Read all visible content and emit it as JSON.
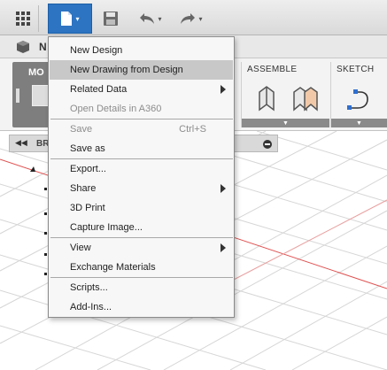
{
  "tabs": {
    "model_tab_label": "N"
  },
  "ribbon": {
    "mode_label": "MO",
    "assemble_title": "ASSEMBLE",
    "sketch_title": "SKETCH",
    "panel_caret": "▼"
  },
  "browser": {
    "arrows": "◀◀",
    "label": "BR"
  },
  "toolbar": {
    "caret": "▾"
  },
  "file_menu": {
    "items": [
      {
        "label": "New Design"
      },
      {
        "label": "New Drawing from Design"
      },
      {
        "label": "Related Data"
      },
      {
        "label": "Open Details in A360"
      },
      {
        "label": "Save",
        "shortcut": "Ctrl+S"
      },
      {
        "label": "Save as"
      },
      {
        "label": "Export..."
      },
      {
        "label": "Share"
      },
      {
        "label": "3D Print"
      },
      {
        "label": "Capture Image..."
      },
      {
        "label": "View"
      },
      {
        "label": "Exchange Materials"
      },
      {
        "label": "Scripts..."
      },
      {
        "label": "Add-Ins..."
      }
    ]
  },
  "colors": {
    "file_button": "#2d74c2",
    "highlight": "#c8c8c8",
    "axis_red": "#e05050",
    "accent_blue": "#2f6fcf"
  },
  "icons": [
    "grid-icon",
    "file-icon",
    "save-icon",
    "undo-icon",
    "redo-icon",
    "joint-icon",
    "as-built-joint-icon",
    "create-sketch-icon",
    "submenu-arrow-icon"
  ]
}
